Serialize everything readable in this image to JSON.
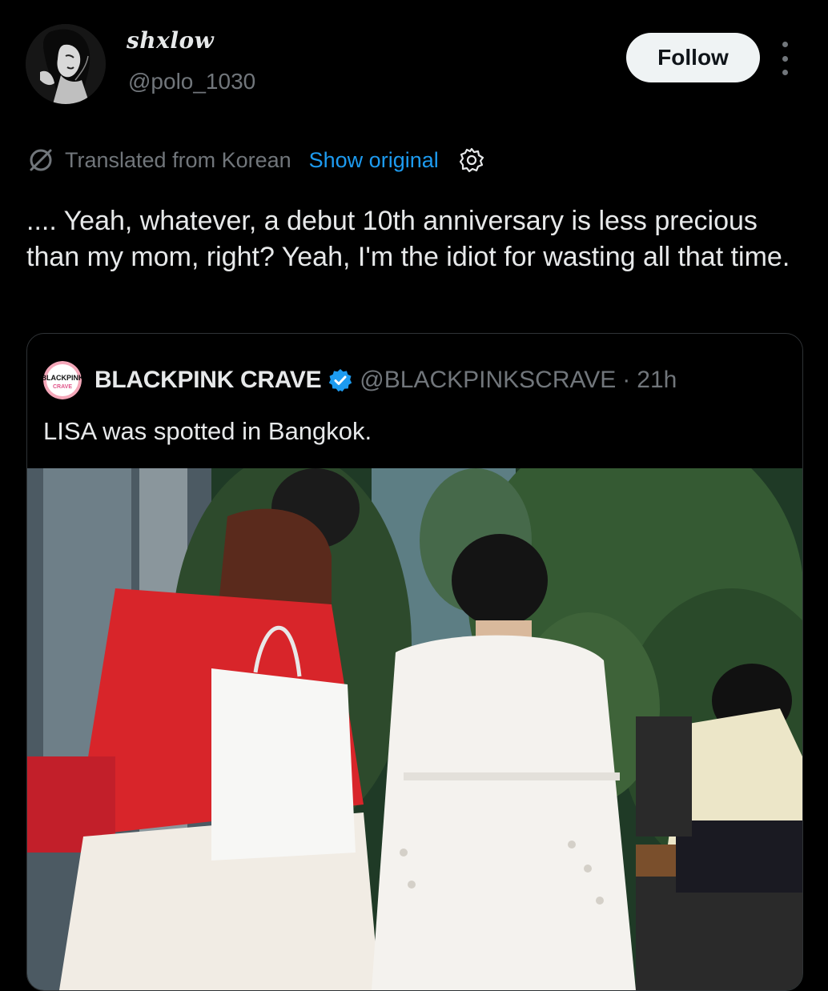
{
  "author": {
    "display_name": "shxlow",
    "handle": "@polo_1030",
    "avatar_icon": "profile-photo"
  },
  "actions": {
    "follow_label": "Follow",
    "more_icon": "more-vertical-icon"
  },
  "translation": {
    "note": "Translated from Korean",
    "show_original_label": "Show original",
    "settings_icon": "gear-icon"
  },
  "tweet": {
    "text": ".... Yeah, whatever, a debut 10th anniversary is less precious than my mom, right? Yeah, I'm the idiot for wasting all that time."
  },
  "quote": {
    "avatar_logo": {
      "line1": "BLACKPINK",
      "line2": "CRAVE"
    },
    "name": "BLACKPINK CRAVE",
    "verified": true,
    "handle": "@BLACKPINKSCRAVE",
    "separator": "·",
    "time": "21h",
    "text": "LISA was spotted in Bangkok."
  },
  "colors": {
    "background": "#000000",
    "primary_text": "#e7e9ea",
    "secondary_text": "#71767b",
    "link": "#1d9bf0",
    "verified_badge": "#1d9bf0",
    "border": "#2f3336"
  }
}
